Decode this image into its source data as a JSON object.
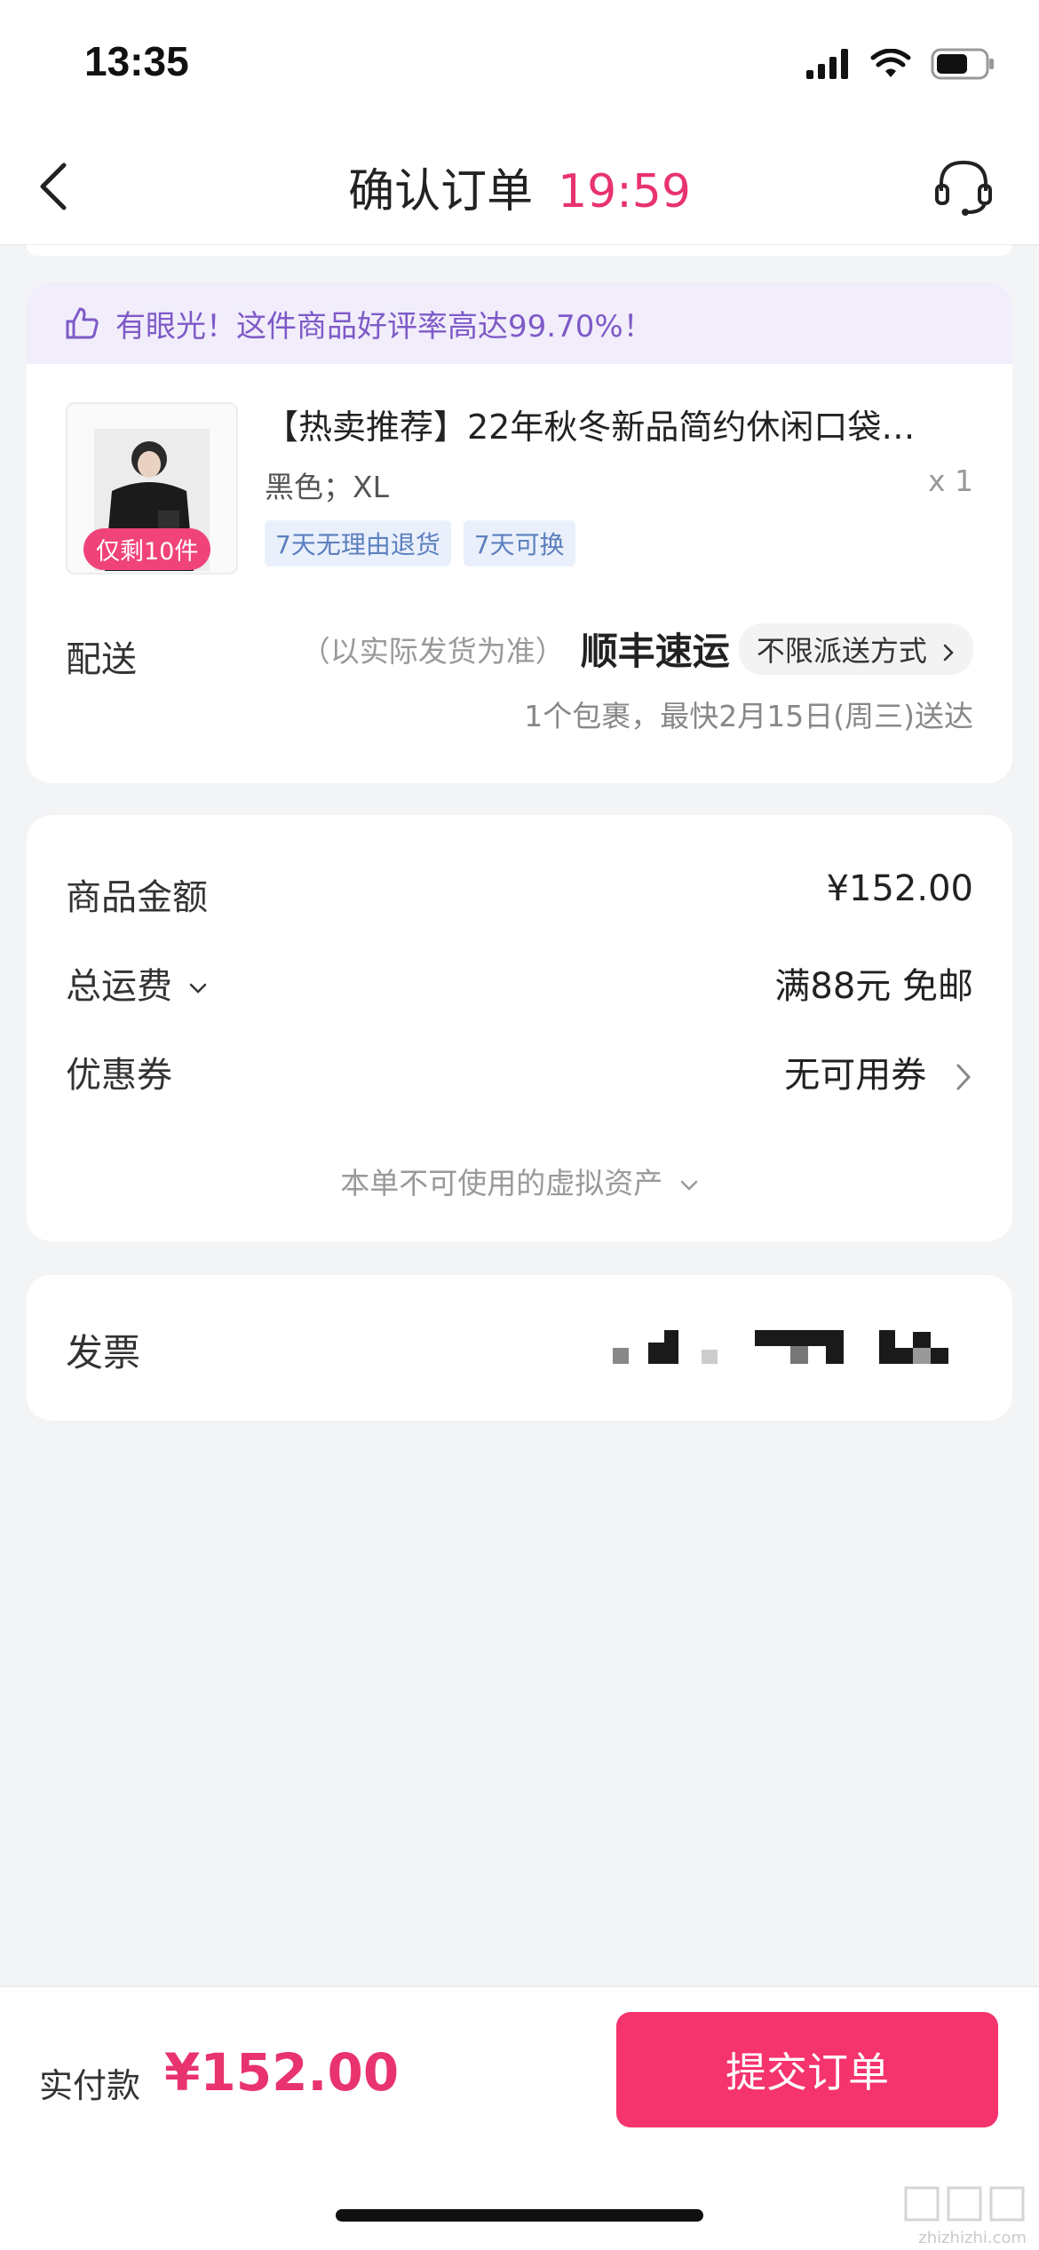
{
  "status_bar": {
    "time": "13:35"
  },
  "nav": {
    "title": "确认订单",
    "timer": "19:59"
  },
  "banner": {
    "text": "有眼光！这件商品好评率高达99.70%！"
  },
  "product": {
    "title": "【热卖推荐】22年秋冬新品简约休闲口袋…",
    "spec": "黑色；XL",
    "quantity": "x 1",
    "stock_badge": "仅剩10件",
    "tags": [
      "7天无理由退货",
      "7天可换"
    ]
  },
  "shipping": {
    "label": "配送",
    "note": "（以实际发货为准）",
    "carrier": "顺丰速运",
    "method": "不限派送方式",
    "eta": "1个包裹，最快2月15日(周三)送达"
  },
  "price": {
    "rows": [
      {
        "label": "商品金额",
        "value": "¥152.00"
      },
      {
        "label": "总运费",
        "value": "满88元 免邮"
      },
      {
        "label": "优惠券",
        "value": "无可用券"
      }
    ],
    "virtual_assets": "本单不可使用的虚拟资产"
  },
  "invoice": {
    "label": "发票"
  },
  "footer": {
    "pay_label": "实付款",
    "pay_amount": "¥152.00",
    "submit": "提交订单"
  },
  "watermark": {
    "text": "zhizhizhi.com"
  },
  "colors": {
    "accent": "#e8336e",
    "button": "#f5336d",
    "banner_bg": "#f1edfb",
    "banner_text": "#7e5ac7",
    "tag_bg": "#eaf0fb",
    "tag_text": "#5b7fbf"
  }
}
